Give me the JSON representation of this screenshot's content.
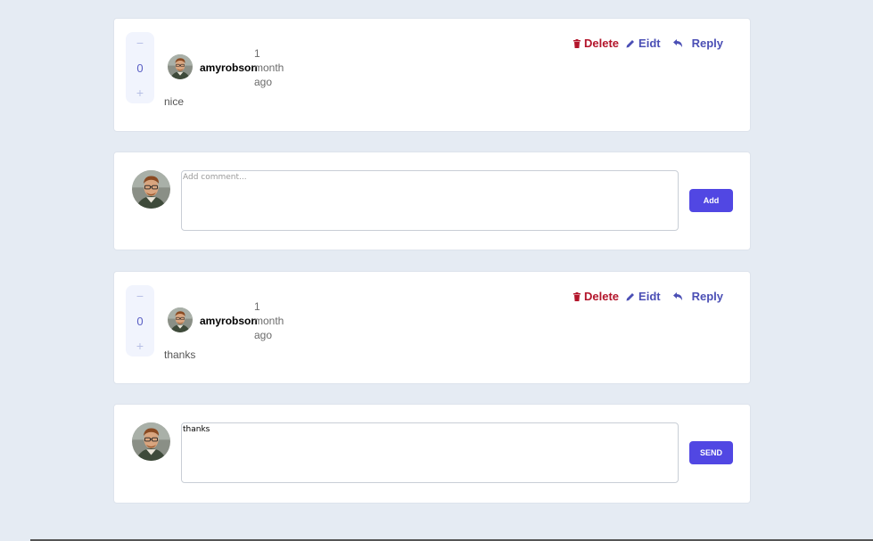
{
  "comments": [
    {
      "score": "0",
      "minus": "−",
      "plus": "+",
      "username": "amyrobson",
      "time_lines": [
        "1",
        "month",
        "ago"
      ],
      "content": "nice",
      "actions": {
        "delete": "Delete",
        "edit": "Eidt",
        "reply": "Reply"
      }
    },
    {
      "score": "0",
      "minus": "−",
      "plus": "+",
      "username": "amyrobson",
      "time_lines": [
        "1",
        "month",
        "ago"
      ],
      "content": "thanks",
      "actions": {
        "delete": "Delete",
        "edit": "Eidt",
        "reply": "Reply"
      }
    }
  ],
  "add_comment": {
    "placeholder": "Add comment...",
    "value": "",
    "button": "Add"
  },
  "reply_box": {
    "placeholder": "",
    "value": "thanks",
    "button": "SEND"
  },
  "colors": {
    "primary": "#5147e3",
    "delete": "#b3152b",
    "link": "#4b4fb5",
    "background": "#e5ebf3"
  }
}
